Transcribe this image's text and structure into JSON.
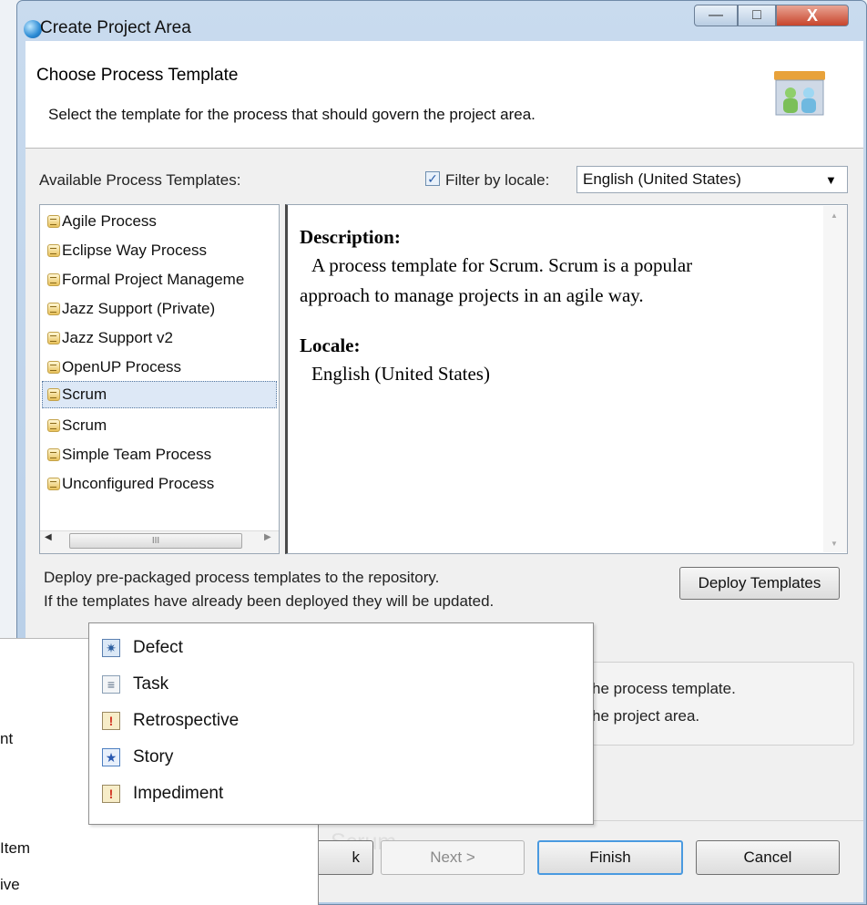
{
  "window": {
    "title": "Create Project Area",
    "controls": {
      "minimize": "—",
      "maximize": "□",
      "close": "X"
    }
  },
  "header": {
    "heading": "Choose Process Template",
    "subtitle": "Select the template for the process that should govern the project area."
  },
  "templates": {
    "label": "Available Process Templates:",
    "items": [
      "Agile Process",
      "Eclipse Way Process",
      "Formal Project Manageme",
      "Jazz Support (Private)",
      "Jazz Support v2",
      "OpenUP Process",
      "Scrum",
      "Scrum",
      "Simple Team Process",
      "Unconfigured Process"
    ],
    "selected_index": 6,
    "scroll_glyph": "III"
  },
  "filter": {
    "checked": true,
    "label": "Filter by locale:",
    "locale_value": "English (United States)"
  },
  "description": {
    "heading": "Description:",
    "line1": "A process template for Scrum. Scrum is a popular",
    "line2": "approach to manage projects in an agile way.",
    "locale_heading": "Locale:",
    "locale_value": "English (United States)"
  },
  "deploy": {
    "line1": "Deploy pre-packaged process templates to the repository.",
    "line2": "If the templates have already been deployed they will be updated.",
    "button": "Deploy Templates"
  },
  "group": {
    "line1": "he process template.",
    "line2": "he project area."
  },
  "buttons": {
    "back": "k",
    "next": "Next >",
    "finish": "Finish",
    "cancel": "Cancel"
  },
  "ghost_text": "Scrum",
  "left_panel": {
    "items": [
      "nt",
      "Item",
      "ive"
    ]
  },
  "dropdown": {
    "items": [
      {
        "label": "Defect",
        "icon": "defect-icon"
      },
      {
        "label": "Task",
        "icon": "task-icon"
      },
      {
        "label": "Retrospective",
        "icon": "retrospective-icon"
      },
      {
        "label": "Story",
        "icon": "story-icon"
      },
      {
        "label": "Impediment",
        "icon": "impediment-icon"
      }
    ]
  }
}
